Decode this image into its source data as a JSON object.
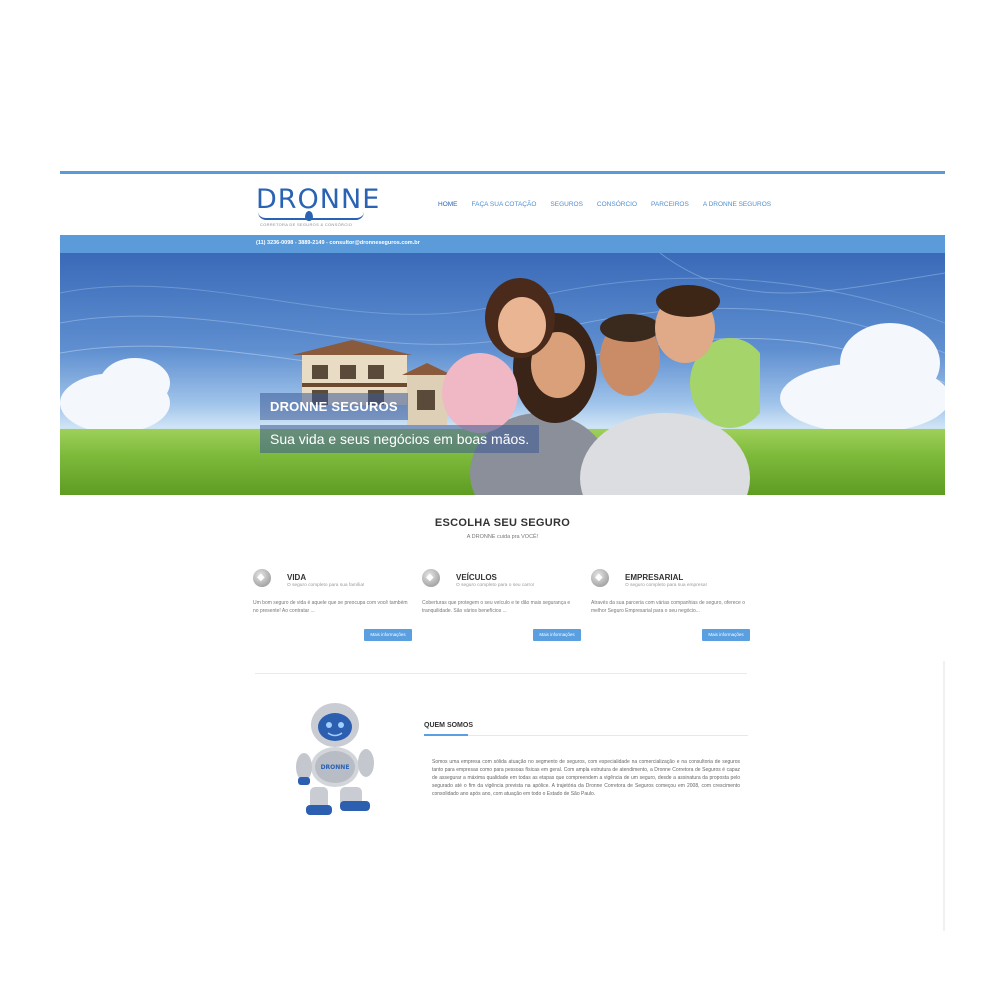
{
  "header": {
    "logo_text": "DRONNE",
    "logo_tagline": "CORRETORA DE SEGUROS & CONSÓRCIO",
    "nav": [
      {
        "label": "HOME"
      },
      {
        "label": "FAÇA SUA COTAÇÃO"
      },
      {
        "label": "SEGUROS"
      },
      {
        "label": "CONSÓRCIO"
      },
      {
        "label": "PARCEIROS"
      },
      {
        "label": "A DRONNE SEGUROS"
      }
    ]
  },
  "contact_bar": {
    "text": "(11) 3236-0098 - 3889-2149 - consultor@dronneseguros.com.br"
  },
  "hero": {
    "title": "DRONNE SEGUROS",
    "subtitle": "Sua vida e seus negócios em boas mãos."
  },
  "choose": {
    "title": "ESCOLHA SEU SEGURO",
    "subtitle": "A DRONNE cuida pra VOCÊ!",
    "cards": [
      {
        "title": "VIDA",
        "tagline": "O seguro completo para sua família!",
        "description": "Um bom seguro de vida é aquele que se preocupa com você também no presente! Ao contratar ...",
        "button": "Mais informações"
      },
      {
        "title": "VEÍCULOS",
        "tagline": "O seguro completo para o seu carro!",
        "description": "Coberturas que protegem o seu veículo e te dão mais segurança e tranquilidade. São vários benefícios ...",
        "button": "Mais informações"
      },
      {
        "title": "EMPRESARIAL",
        "tagline": "O seguro completo para sua empresa!",
        "description": "Através da sua parceria com várias companhias de seguro, oferece o melhor Seguro Empresarial para o seu negócio...",
        "button": "Mais informações"
      }
    ]
  },
  "about": {
    "title": "QUEM SOMOS",
    "robot_label": "DRONNE",
    "text": "Somos uma empresa com sólida atuação no segmento de seguros, com especialidade na comercialização e na consultoria de seguros tanto para empresas como para pessoas físicas em geral. Com ampla estrutura de atendimento, a Dronne Corretora de Seguros é capaz de assegurar a máxima qualidade em todas as etapas que compreendem a vigência de um seguro, desde a assinatura da proposta pelo segurado até o fim da vigência prevista na apólice. A trajetória da Dronne Corretora de Seguros começou em 2008, com crescimento consolidado ano após ano, com atuação em todo o Estado de São Paulo."
  },
  "colors": {
    "brand_blue": "#2a62b4",
    "bar_blue": "#5b9bd9",
    "button_blue": "#5a9fe0"
  },
  "icons": {
    "vida": "shield-icon",
    "veiculos": "car-shield-icon",
    "empresarial": "building-shield-icon"
  }
}
